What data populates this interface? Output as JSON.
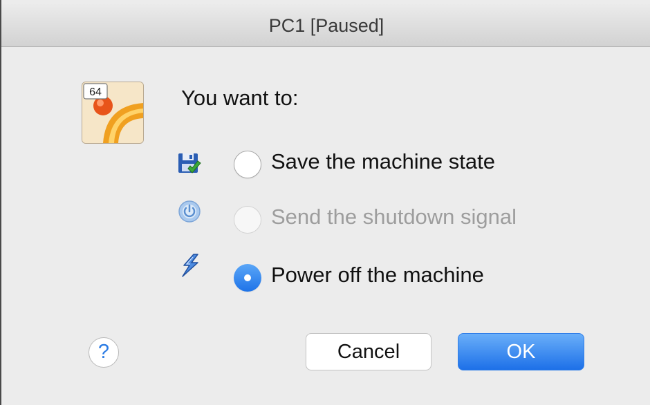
{
  "window": {
    "title": "PC1 [Paused]"
  },
  "app_icon": {
    "badge": "64",
    "icon": "virtualbox-vm-icon"
  },
  "prompt": "You want to:",
  "options": [
    {
      "label": "Save the machine state",
      "icon": "save-state-icon",
      "selected": false,
      "enabled": true
    },
    {
      "label": "Send the shutdown signal",
      "icon": "power-button-icon",
      "selected": false,
      "enabled": false
    },
    {
      "label": "Power off the machine",
      "icon": "lightning-icon",
      "selected": true,
      "enabled": true
    }
  ],
  "buttons": {
    "help_label": "?",
    "cancel_label": "Cancel",
    "ok_label": "OK"
  },
  "colors": {
    "accent": "#1d70e8",
    "disabled_text": "#9d9d9d",
    "dialog_background": "#ececec"
  }
}
